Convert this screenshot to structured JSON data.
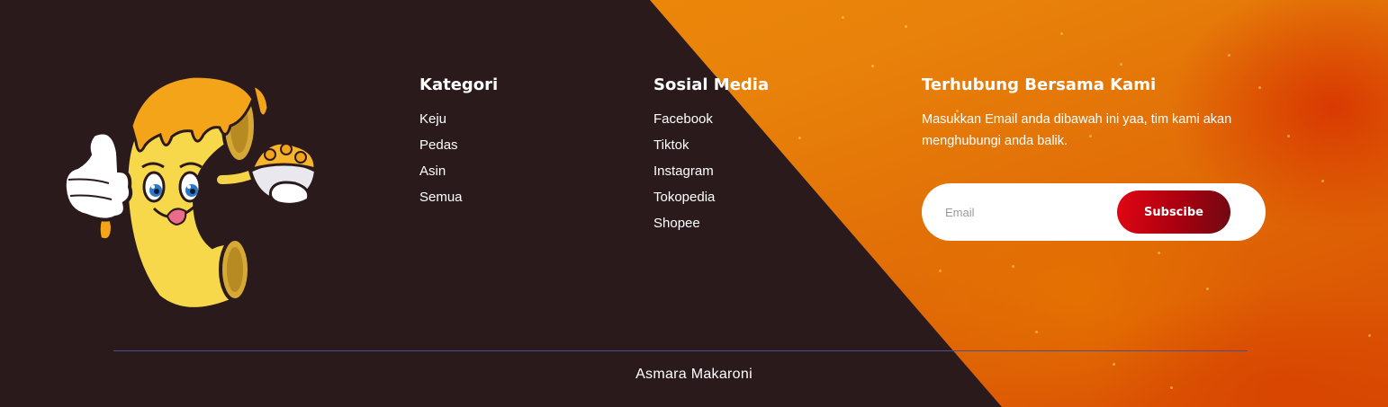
{
  "colors": {
    "dark_background": "#2b1a1c",
    "orange_accent": "#f08d0c",
    "subscribe_button": "#c4000f",
    "divider": "#4a4f85",
    "text": "#ffffff"
  },
  "brand": {
    "mascot_icon": "macaroni-mascot-thumbs-up-icon"
  },
  "kategori": {
    "title": "Kategori",
    "items": [
      "Keju",
      "Pedas",
      "Asin",
      "Semua"
    ]
  },
  "sosial_media": {
    "title": "Sosial Media",
    "items": [
      "Facebook",
      "Tiktok",
      "Instagram",
      "Tokopedia",
      "Shopee"
    ]
  },
  "contact": {
    "title": "Terhubung Bersama Kami",
    "description": "Masukkan Email anda dibawah ini yaa, tim kami akan menghubungi anda balik.",
    "email_placeholder": "Email",
    "subscribe_label": "Subscibe"
  },
  "footer": {
    "copyright": "Asmara Makaroni"
  }
}
